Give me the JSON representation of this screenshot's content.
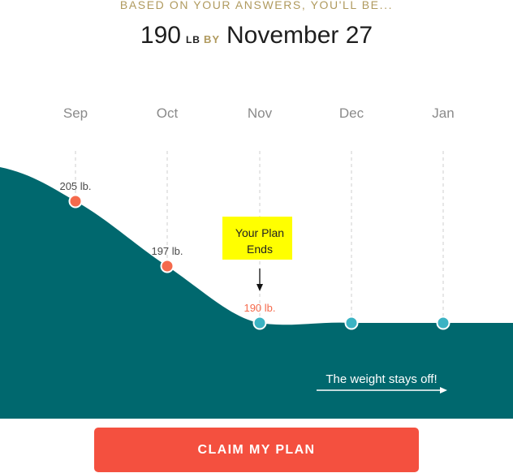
{
  "header": {
    "subtitle": "BASED ON YOUR ANSWERS, YOU'LL BE...",
    "goal_weight": "190",
    "unit": "LB",
    "by_label": "BY",
    "goal_date": "November 27"
  },
  "chart_data": {
    "type": "area",
    "title": "",
    "xlabel": "",
    "ylabel": "",
    "grid": "vertical dashed lines at months",
    "categories": [
      "Sep",
      "Oct",
      "Nov",
      "Dec",
      "Jan"
    ],
    "values": [
      205,
      197,
      190,
      190,
      190
    ],
    "point_labels": [
      "205 lb.",
      "197 lb.",
      "190 lb.",
      "",
      ""
    ],
    "point_status": [
      "progress",
      "progress",
      "goal",
      "maintain",
      "maintain"
    ],
    "annotation": {
      "text_line1": "Your Plan",
      "text_line2": "Ends",
      "at_category": "Nov"
    },
    "footer_note": "The weight stays off!",
    "colors": {
      "area": "#00686e",
      "progress_point": "#f56a4c",
      "maintain_point": "#3bb3c3",
      "goal_label": "#f56a4c",
      "annotation_bg": "#ffff00",
      "month_label": "#8a8a8a",
      "grid": "#cfcfcf"
    }
  },
  "cta": {
    "label": "CLAIM MY PLAN"
  }
}
